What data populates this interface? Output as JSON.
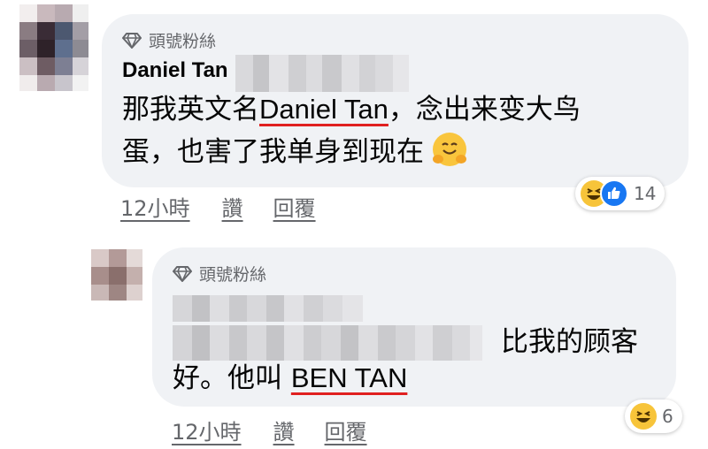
{
  "comments": [
    {
      "badge": "頭號粉絲",
      "author": "Daniel Tan",
      "text_line1_a": "那我英文名",
      "text_line1_name": "Daniel Tan",
      "text_line1_b": "，念出来变大鸟",
      "text_line2": "蛋，也害了我单身到现在",
      "time": "12小時",
      "like_label": "讚",
      "reply_label": "回覆",
      "reaction_count": "14",
      "reactions": [
        "haha-icon",
        "like-icon"
      ]
    },
    {
      "badge": "頭號粉絲",
      "text_line2_visible": "比我的顾客",
      "text_line3_a": "好。他叫 ",
      "text_line3_name": "BEN TAN",
      "time": "12小時",
      "like_label": "讚",
      "reply_label": "回覆",
      "reaction_count": "6",
      "reactions": [
        "haha-icon"
      ]
    }
  ],
  "colors": {
    "bubble": "#f0f2f5",
    "muted_text": "#65676b",
    "underline_red": "#e02020",
    "like_blue": "#1877f2",
    "haha_yellow": "#f7c43a"
  }
}
